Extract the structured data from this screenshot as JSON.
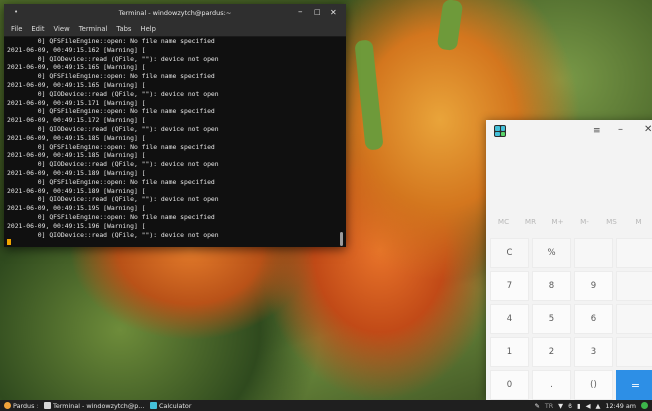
{
  "terminal": {
    "title": "Terminal - windowzytch@pardus:~",
    "controls": {
      "minimize": "–",
      "maximize": "□",
      "close": "✕"
    },
    "menu": [
      "File",
      "Edit",
      "View",
      "Terminal",
      "Tabs",
      "Help"
    ],
    "lines": [
      "        0] QFSFileEngine::open: No file name specified",
      "2021-06-09, 00:49:15.162 [Warning] [",
      "        0] QIODevice::read (QFile, \"\"): device not open",
      "2021-06-09, 00:49:15.165 [Warning] [",
      "        0] QFSFileEngine::open: No file name specified",
      "2021-06-09, 00:49:15.165 [Warning] [",
      "        0] QIODevice::read (QFile, \"\"): device not open",
      "2021-06-09, 00:49:15.171 [Warning] [",
      "        0] QFSFileEngine::open: No file name specified",
      "2021-06-09, 00:49:15.172 [Warning] [",
      "        0] QIODevice::read (QFile, \"\"): device not open",
      "2021-06-09, 00:49:15.185 [Warning] [",
      "        0] QFSFileEngine::open: No file name specified",
      "2021-06-09, 00:49:15.185 [Warning] [",
      "        0] QIODevice::read (QFile, \"\"): device not open",
      "2021-06-09, 00:49:15.189 [Warning] [",
      "        0] QFSFileEngine::open: No file name specified",
      "2021-06-09, 00:49:15.189 [Warning] [",
      "        0] QIODevice::read (QFile, \"\"): device not open",
      "2021-06-09, 00:49:15.195 [Warning] [",
      "        0] QFSFileEngine::open: No file name specified",
      "2021-06-09, 00:49:15.196 [Warning] [",
      "        0] QIODevice::read (QFile, \"\"): device not open"
    ]
  },
  "calculator": {
    "controls": {
      "menu": "≡",
      "minimize": "–",
      "close": "✕"
    },
    "memory": [
      "MC",
      "MR",
      "M+",
      "M-",
      "MS",
      "M"
    ],
    "keys": [
      [
        "C",
        "%",
        "",
        ""
      ],
      [
        "7",
        "8",
        "9",
        ""
      ],
      [
        "4",
        "5",
        "6",
        ""
      ],
      [
        "1",
        "2",
        "3",
        ""
      ],
      [
        "0",
        ".",
        "()",
        "="
      ]
    ]
  },
  "taskbar": {
    "start_label": "Pardus",
    "items": [
      "Terminal - windowzytch@p...",
      "Calculator"
    ],
    "clock": "12:49 am",
    "tray_text": "TR"
  },
  "colors": {
    "accent": "#2d8fe6",
    "cursor": "#f0a400"
  }
}
